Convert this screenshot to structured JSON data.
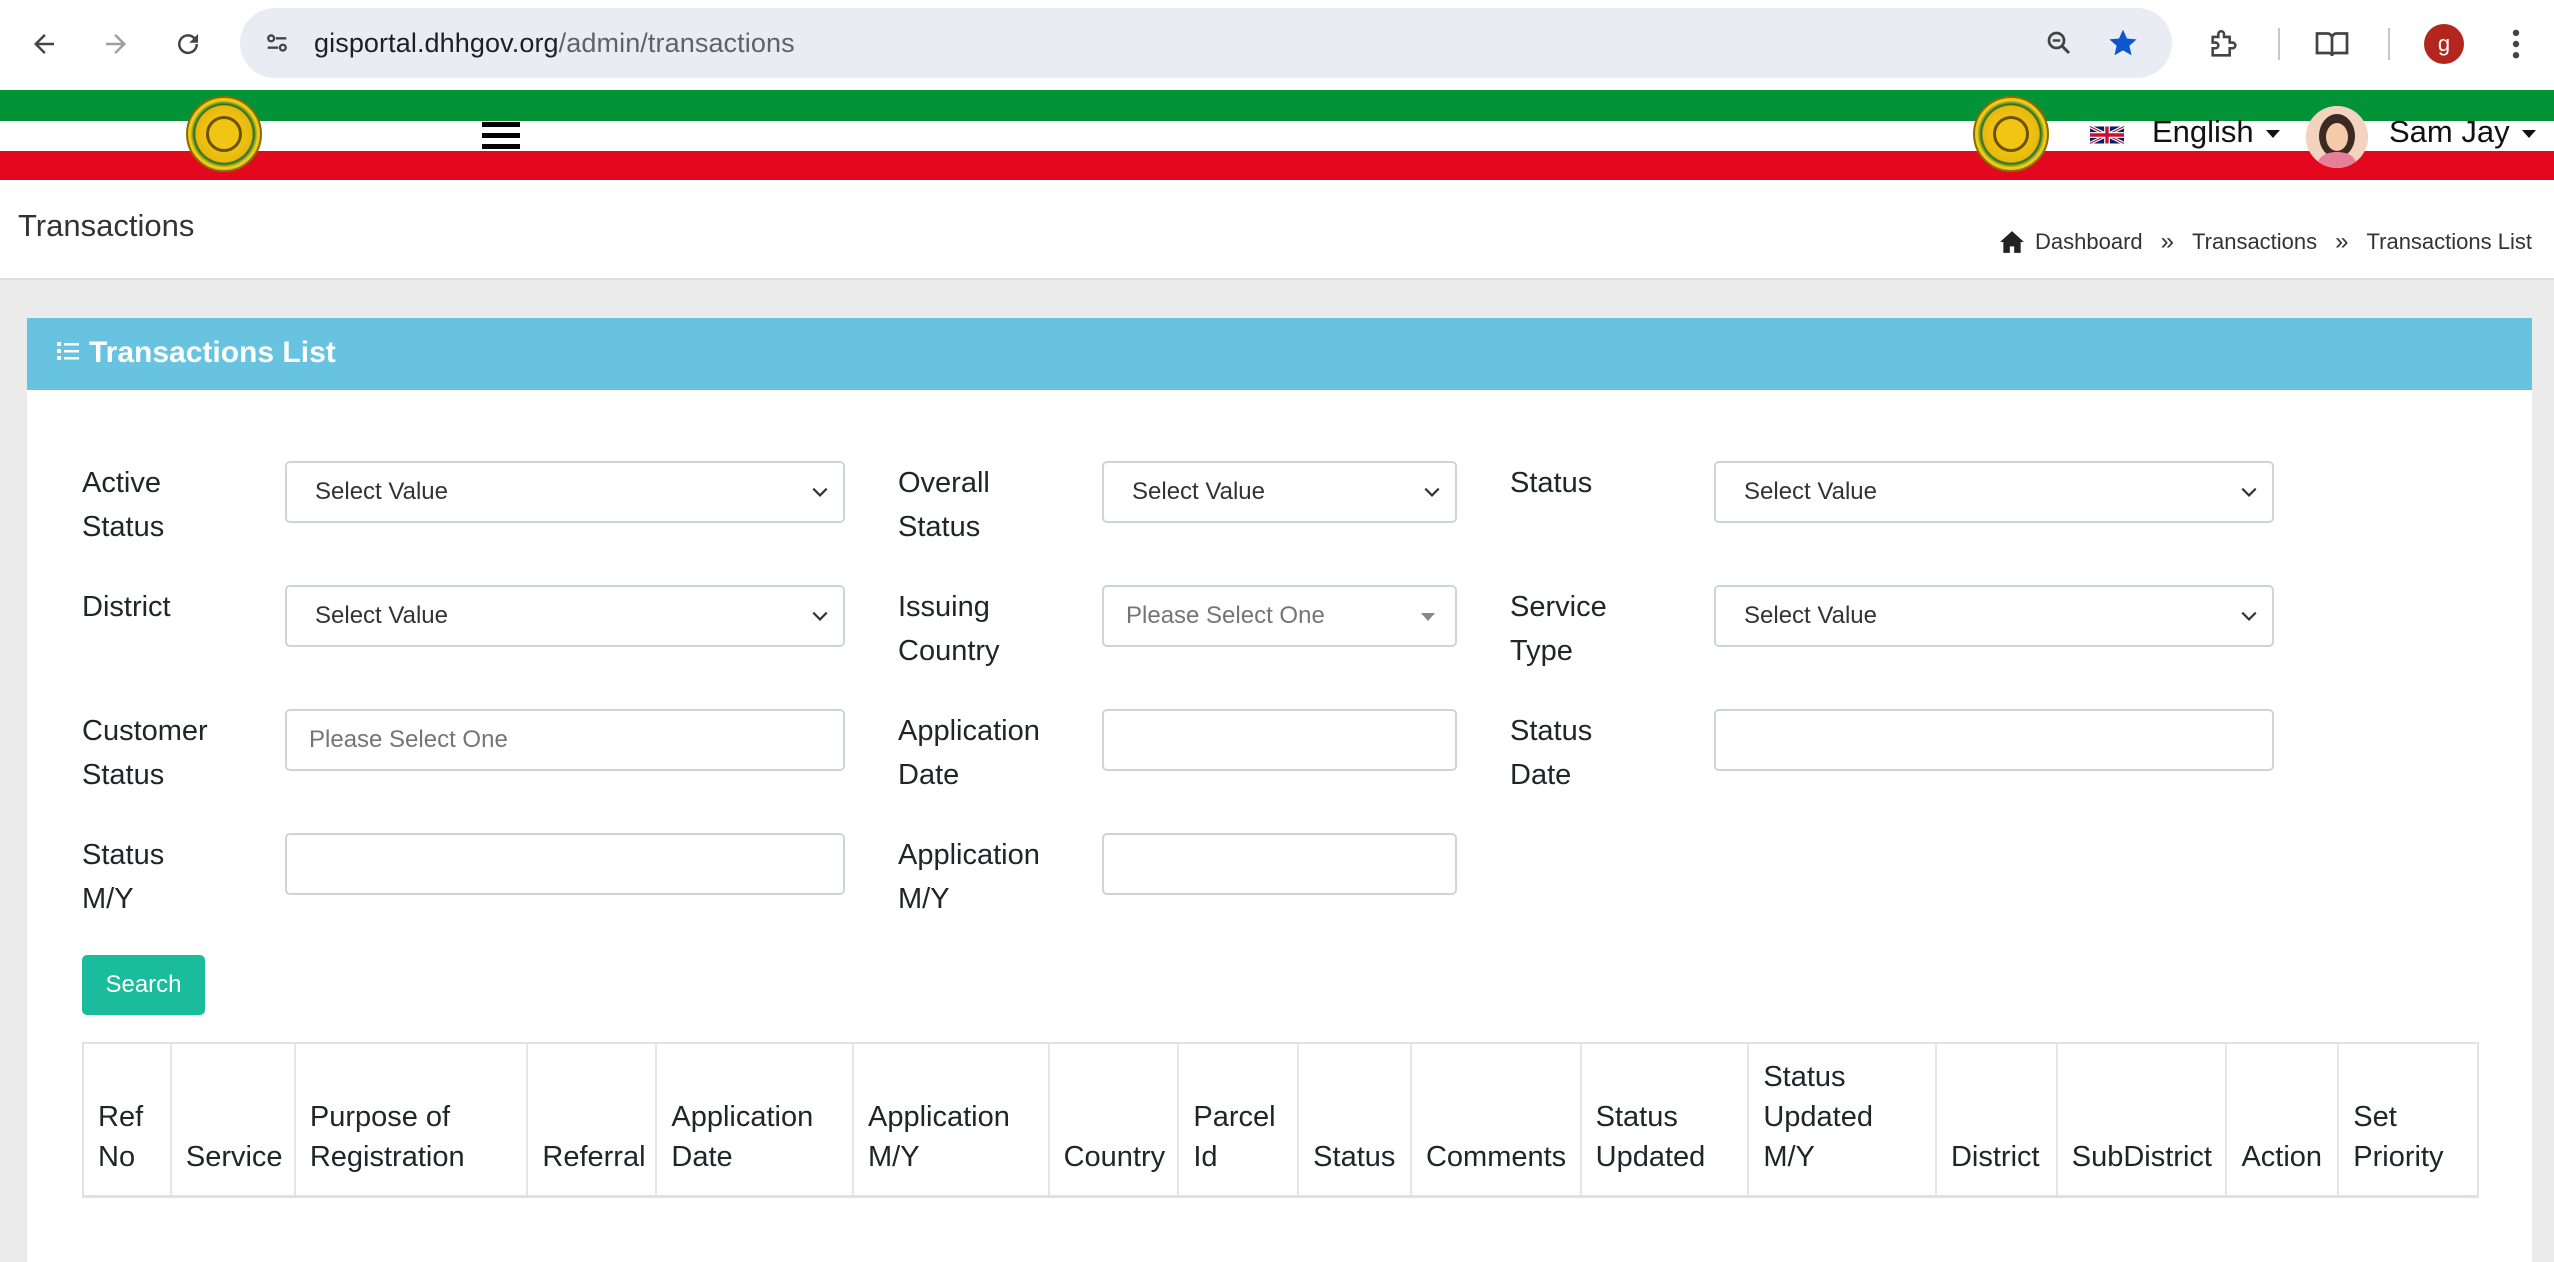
{
  "browser": {
    "url_host": "gisportal.dhhgov.org",
    "url_path": "/admin/transactions",
    "profile_initial": "g"
  },
  "header": {
    "language": "English",
    "user_name": "Sam Jay"
  },
  "page": {
    "title": "Transactions",
    "breadcrumb": [
      "Dashboard",
      "Transactions",
      "Transactions List"
    ],
    "breadcrumb_separator": "»"
  },
  "card": {
    "title": "Transactions List"
  },
  "filters": {
    "active_status": {
      "label_l1": "Active",
      "label_l2": "Status",
      "value": "Select Value"
    },
    "overall_status": {
      "label_l1": "Overall",
      "label_l2": "Status",
      "value": "Select Value"
    },
    "status": {
      "label_l1": "Status",
      "value": "Select Value"
    },
    "district": {
      "label_l1": "District",
      "value": "Select Value"
    },
    "issuing_country": {
      "label_l1": "Issuing",
      "label_l2": "Country",
      "placeholder": "Please Select One"
    },
    "service_type": {
      "label_l1": "Service",
      "label_l2": "Type",
      "value": "Select Value"
    },
    "customer_status": {
      "label_l1": "Customer",
      "label_l2": "Status",
      "placeholder": "Please Select One"
    },
    "application_date": {
      "label_l1": "Application",
      "label_l2": "Date",
      "value": ""
    },
    "status_date": {
      "label_l1": "Status",
      "label_l2": "Date",
      "value": ""
    },
    "status_my": {
      "label_l1": "Status",
      "label_l2": "M/Y",
      "value": ""
    },
    "application_my": {
      "label_l1": "Application",
      "label_l2": "M/Y",
      "value": ""
    },
    "search_label": "Search"
  },
  "table": {
    "columns": [
      [
        "Ref",
        "No"
      ],
      [
        "Service"
      ],
      [
        "Purpose of",
        "Registration"
      ],
      [
        "Referral"
      ],
      [
        "Application",
        "Date"
      ],
      [
        "Application",
        "M/Y"
      ],
      [
        "Country"
      ],
      [
        "Parcel",
        "Id"
      ],
      [
        "Status"
      ],
      [
        "Comments"
      ],
      [
        "Status",
        "Updated"
      ],
      [
        "Status",
        "Updated",
        "M/Y"
      ],
      [
        "District"
      ],
      [
        "SubDistrict"
      ],
      [
        "Action"
      ],
      [
        "Set",
        "Priority"
      ]
    ]
  },
  "colors": {
    "header_green": "#029237",
    "header_red": "#e4081f",
    "card_header": "#67c3e0",
    "search_button": "#1abc9c"
  }
}
